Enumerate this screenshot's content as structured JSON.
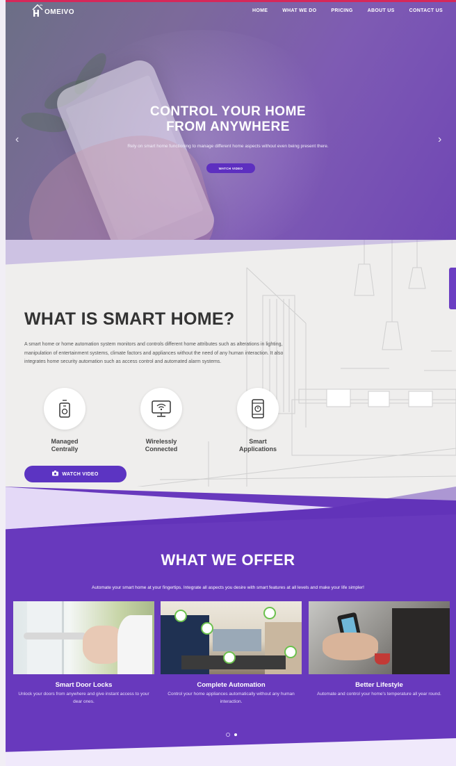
{
  "brand": {
    "logo_text": "OMEIVO"
  },
  "nav": {
    "items": [
      "HOME",
      "WHAT WE DO",
      "PRICING",
      "ABOUT US",
      "CONTACT US"
    ]
  },
  "hero": {
    "title_line1": "CONTROL YOUR HOME",
    "title_line2": "FROM ANYWHERE",
    "subtitle": "Rely on smart home functioning to manage different home aspects without even being present there.",
    "button": "WATCH VIDEO",
    "prev_arrow": "‹",
    "next_arrow": "›"
  },
  "whatis": {
    "title": "WHAT IS SMART HOME?",
    "description": "A smart home or home automation system monitors and controls different home attributes such as alterations in lighting, manipulation of entertainment systems, climate factors and appliances without the need of any human interaction. It also integrates home security automation such as access control and automated alarm systems.",
    "features": [
      {
        "label_line1": "Managed",
        "label_line2": "Centrally",
        "icon": "remote-icon"
      },
      {
        "label_line1": "Wirelessly",
        "label_line2": "Connected",
        "icon": "monitor-wifi-icon"
      },
      {
        "label_line1": "Smart",
        "label_line2": "Applications",
        "icon": "smartphone-app-icon"
      }
    ],
    "button": "WATCH VIDEO"
  },
  "offer": {
    "title": "WHAT WE OFFER",
    "subtitle": "Automate your smart home at your fingertips. Integrate all aspects you desire with smart features at all levels and make your life simpler!",
    "cards": [
      {
        "title": "Smart Door Locks",
        "desc": "Unlock your doors from anywhere and give instant access to your dear ones."
      },
      {
        "title": "Complete Automation",
        "desc": "Control your home appliances automatically without any human interaction."
      },
      {
        "title": "Better Lifestyle",
        "desc": "Automate and control your home's temperature all year round."
      }
    ]
  },
  "colors": {
    "accent": "#6839bd",
    "button": "#5c34c2",
    "top_bar": "#d6285a"
  }
}
